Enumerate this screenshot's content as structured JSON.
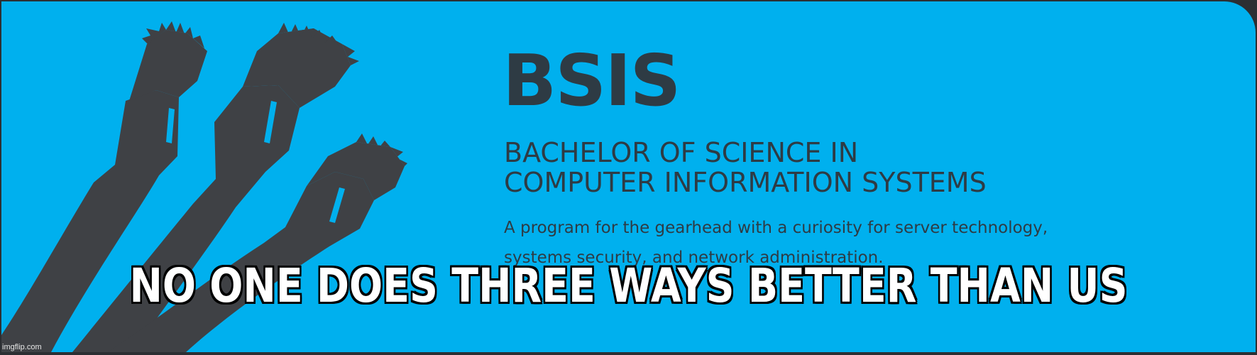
{
  "banner": {
    "title": "BSIS",
    "subtitle_lines": [
      "BACHELOR OF SCIENCE IN",
      "COMPUTER INFORMATION SYSTEMS"
    ],
    "description_lines": [
      "A program for the gearhead with a curiosity for server technology,",
      "systems security, and network administration."
    ],
    "background_color": "#00b0ee",
    "text_color": "#2e3b44",
    "graphic_icon": "network-cables-icon"
  },
  "meme": {
    "caption": "NO ONE DOES THREE WAYS BETTER THAN US",
    "caption_color": "#ffffff"
  },
  "watermark": {
    "text": "imgflip.com"
  }
}
